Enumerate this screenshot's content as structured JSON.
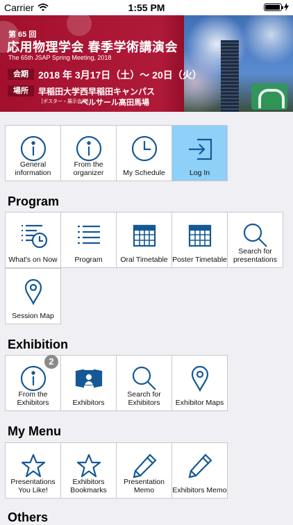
{
  "status_bar": {
    "carrier": "Carrier",
    "time": "1:55 PM",
    "battery_level": 0.95
  },
  "banner": {
    "edition": "第 65 回",
    "title": "応用物理学会 春季学術講演会",
    "subtitle": "The 65th JSAP Spring Meeting, 2018",
    "period_label": "会期",
    "dates": "2018 年 3月17日（土）～ 20日（火）",
    "venue_label": "場所",
    "venue": "早稲田大学西早稲田キャンパス",
    "venue2_note": "［ポスター・展示会場］",
    "venue2": "ベルサール高田馬場"
  },
  "top_tiles": [
    {
      "label": "General information",
      "icon": "info-icon"
    },
    {
      "label": "From the organizer",
      "icon": "info-icon"
    },
    {
      "label": "My Schedule",
      "icon": "clock-icon"
    },
    {
      "label": "Log In",
      "icon": "login-icon"
    }
  ],
  "sections": {
    "program": {
      "title": "Program",
      "tiles": [
        {
          "label": "What's on Now",
          "icon": "list-clock-icon"
        },
        {
          "label": "Program",
          "icon": "list-icon"
        },
        {
          "label": "Oral Timetable",
          "icon": "calendar-icon"
        },
        {
          "label": "Poster Timetable",
          "icon": "calendar-icon"
        },
        {
          "label": "Search for presentations",
          "icon": "search-icon"
        },
        {
          "label": "Session Map",
          "icon": "map-pin-icon"
        }
      ]
    },
    "exhibition": {
      "title": "Exhibition",
      "tiles": [
        {
          "label": "From the Exhibitors",
          "icon": "info-icon",
          "badge": "2"
        },
        {
          "label": "Exhibitors",
          "icon": "exhibitor-icon"
        },
        {
          "label": "Search for Exhibitors",
          "icon": "search-icon"
        },
        {
          "label": "Exhibitor Maps",
          "icon": "map-pin-icon"
        }
      ]
    },
    "my_menu": {
      "title": "My Menu",
      "tiles": [
        {
          "label": "Presentations You Like!",
          "icon": "star-icon"
        },
        {
          "label": "Exhibitors Bookmarks",
          "icon": "star-icon"
        },
        {
          "label": "Presentation Memo",
          "icon": "pencil-icon"
        },
        {
          "label": "Exhibitors Memo",
          "icon": "pencil-icon"
        }
      ]
    },
    "others": {
      "title": "Others"
    }
  },
  "colors": {
    "accent": "#155895",
    "highlight": "#8ed0f8",
    "banner_red": "#a3102e"
  }
}
